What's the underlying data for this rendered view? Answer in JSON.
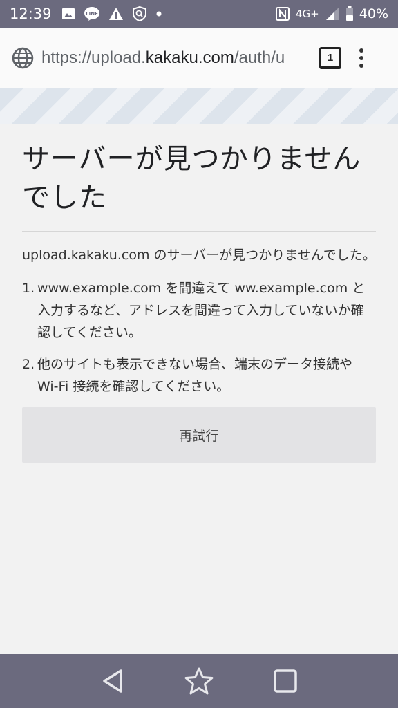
{
  "status_bar": {
    "time": "12:39",
    "network": "4G+",
    "battery": "40%"
  },
  "browser": {
    "url_prefix": "https://upload.",
    "url_domain": "kakaku.com",
    "url_suffix": "/auth/u",
    "tab_count": "1"
  },
  "error_page": {
    "title": "サーバーが見つかりませんでした",
    "description": "upload.kakaku.com のサーバーが見つかりませんでした。",
    "suggestions": [
      {
        "num": "1.",
        "text": "www.example.com を間違えて ww.example.com と入力するなど、アドレスを間違って入力していないか確認してください。"
      },
      {
        "num": "2.",
        "text": "他のサイトも表示できない場合、端末のデータ接続や Wi-Fi 接続を確認してください。"
      }
    ],
    "retry_label": "再試行"
  },
  "colors": {
    "system_bar": "#6b6a7e",
    "url_bar_bg": "#fafafa",
    "page_bg": "#f2f2f2",
    "button_bg": "#e3e3e5"
  }
}
